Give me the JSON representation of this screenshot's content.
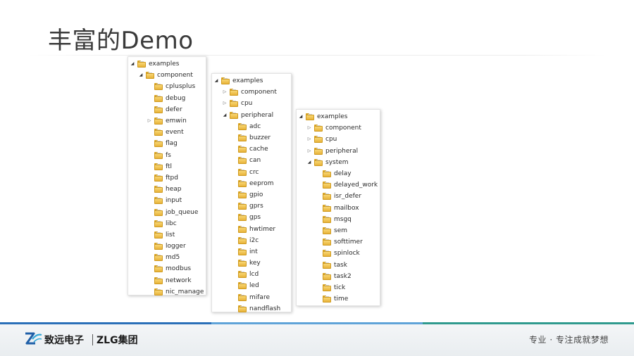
{
  "slide": {
    "title": "丰富的Demo"
  },
  "trees": [
    {
      "rows": [
        {
          "label": "examples",
          "arrow": "expanded",
          "indent": 0
        },
        {
          "label": "component",
          "arrow": "expanded",
          "indent": 1
        },
        {
          "label": "cplusplus",
          "arrow": "none",
          "indent": 2
        },
        {
          "label": "debug",
          "arrow": "none",
          "indent": 2
        },
        {
          "label": "defer",
          "arrow": "none",
          "indent": 2
        },
        {
          "label": "emwin",
          "arrow": "collapsed",
          "indent": 2
        },
        {
          "label": "event",
          "arrow": "none",
          "indent": 2
        },
        {
          "label": "flag",
          "arrow": "none",
          "indent": 2
        },
        {
          "label": "fs",
          "arrow": "none",
          "indent": 2
        },
        {
          "label": "ftl",
          "arrow": "none",
          "indent": 2
        },
        {
          "label": "ftpd",
          "arrow": "none",
          "indent": 2
        },
        {
          "label": "heap",
          "arrow": "none",
          "indent": 2
        },
        {
          "label": "input",
          "arrow": "none",
          "indent": 2
        },
        {
          "label": "job_queue",
          "arrow": "none",
          "indent": 2
        },
        {
          "label": "libc",
          "arrow": "none",
          "indent": 2
        },
        {
          "label": "list",
          "arrow": "none",
          "indent": 2
        },
        {
          "label": "logger",
          "arrow": "none",
          "indent": 2
        },
        {
          "label": "md5",
          "arrow": "none",
          "indent": 2
        },
        {
          "label": "modbus",
          "arrow": "none",
          "indent": 2
        },
        {
          "label": "network",
          "arrow": "none",
          "indent": 2
        },
        {
          "label": "nic_manage",
          "arrow": "none",
          "indent": 2
        }
      ]
    },
    {
      "rows": [
        {
          "label": "examples",
          "arrow": "expanded",
          "indent": 0
        },
        {
          "label": "component",
          "arrow": "collapsed",
          "indent": 1
        },
        {
          "label": "cpu",
          "arrow": "collapsed",
          "indent": 1
        },
        {
          "label": "peripheral",
          "arrow": "expanded",
          "indent": 1
        },
        {
          "label": "adc",
          "arrow": "none",
          "indent": 2
        },
        {
          "label": "buzzer",
          "arrow": "none",
          "indent": 2
        },
        {
          "label": "cache",
          "arrow": "none",
          "indent": 2
        },
        {
          "label": "can",
          "arrow": "none",
          "indent": 2
        },
        {
          "label": "crc",
          "arrow": "none",
          "indent": 2
        },
        {
          "label": "eeprom",
          "arrow": "none",
          "indent": 2
        },
        {
          "label": "gpio",
          "arrow": "none",
          "indent": 2
        },
        {
          "label": "gprs",
          "arrow": "none",
          "indent": 2
        },
        {
          "label": "gps",
          "arrow": "none",
          "indent": 2
        },
        {
          "label": "hwtimer",
          "arrow": "none",
          "indent": 2
        },
        {
          "label": "i2c",
          "arrow": "none",
          "indent": 2
        },
        {
          "label": "int",
          "arrow": "none",
          "indent": 2
        },
        {
          "label": "key",
          "arrow": "none",
          "indent": 2
        },
        {
          "label": "lcd",
          "arrow": "none",
          "indent": 2
        },
        {
          "label": "led",
          "arrow": "none",
          "indent": 2
        },
        {
          "label": "mifare",
          "arrow": "none",
          "indent": 2
        },
        {
          "label": "nandflash",
          "arrow": "none",
          "indent": 2
        }
      ]
    },
    {
      "rows": [
        {
          "label": "examples",
          "arrow": "expanded",
          "indent": 0
        },
        {
          "label": "component",
          "arrow": "collapsed",
          "indent": 1
        },
        {
          "label": "cpu",
          "arrow": "collapsed",
          "indent": 1
        },
        {
          "label": "peripheral",
          "arrow": "collapsed",
          "indent": 1
        },
        {
          "label": "system",
          "arrow": "expanded",
          "indent": 1
        },
        {
          "label": "delay",
          "arrow": "none",
          "indent": 2
        },
        {
          "label": "delayed_work",
          "arrow": "none",
          "indent": 2
        },
        {
          "label": "isr_defer",
          "arrow": "none",
          "indent": 2
        },
        {
          "label": "mailbox",
          "arrow": "none",
          "indent": 2
        },
        {
          "label": "msgq",
          "arrow": "none",
          "indent": 2
        },
        {
          "label": "sem",
          "arrow": "none",
          "indent": 2
        },
        {
          "label": "softtimer",
          "arrow": "none",
          "indent": 2
        },
        {
          "label": "spinlock",
          "arrow": "none",
          "indent": 2
        },
        {
          "label": "task",
          "arrow": "none",
          "indent": 2
        },
        {
          "label": "task2",
          "arrow": "none",
          "indent": 2
        },
        {
          "label": "tick",
          "arrow": "none",
          "indent": 2
        },
        {
          "label": "time",
          "arrow": "none",
          "indent": 2
        }
      ]
    }
  ],
  "footer": {
    "company_cn": "致远电子",
    "company_group": "ZLG集团",
    "slogan": "专业 · 专注成就梦想",
    "logo_colors": {
      "primary": "#1f5fa8",
      "secondary": "#34a8d8"
    },
    "band_colors": [
      "#2a6fb8",
      "#5fa3d8",
      "#2f9a8e"
    ]
  },
  "colors": {
    "folder_fill": "#f0c453",
    "folder_border": "#cf9a1e",
    "title_text": "#3a3a3a"
  }
}
